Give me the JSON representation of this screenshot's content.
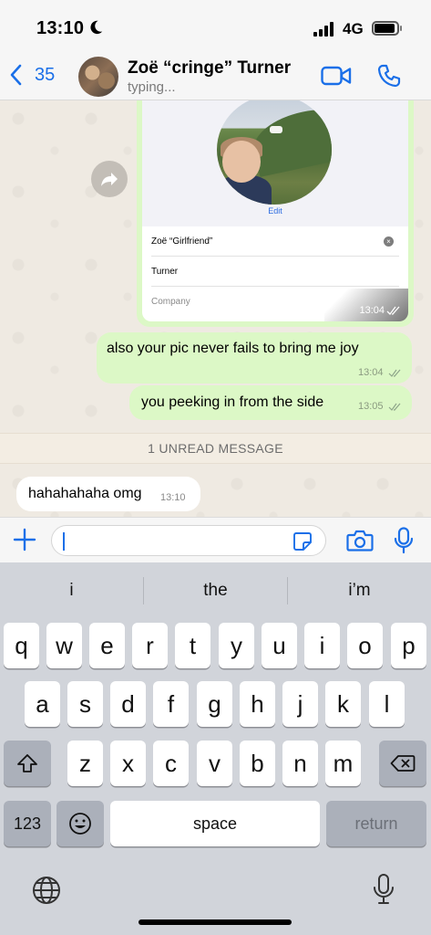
{
  "status_bar": {
    "time": "13:10",
    "network": "4G"
  },
  "header": {
    "back_count": "35",
    "contact_name": "Zoë “cringe” Turner",
    "contact_status": "typing..."
  },
  "contact_card": {
    "edit_label": "Edit",
    "first_name": "Zoë “Girlfriend”",
    "last_name": "Turner",
    "company_placeholder": "Company",
    "time": "13:04"
  },
  "messages": [
    {
      "direction": "outgoing",
      "text": "also your pic never fails to bring me joy",
      "time": "13:04"
    },
    {
      "direction": "outgoing",
      "text": "you peeking in from the side",
      "time": "13:05"
    },
    {
      "direction": "incoming",
      "text": "hahahahaha omg",
      "time": "13:10"
    }
  ],
  "unread_banner": "1 UNREAD MESSAGE",
  "compose": {
    "input_value": ""
  },
  "keyboard": {
    "suggestions": [
      "i",
      "the",
      "i’m"
    ],
    "row1": [
      "q",
      "w",
      "e",
      "r",
      "t",
      "y",
      "u",
      "i",
      "o",
      "p"
    ],
    "row2": [
      "a",
      "s",
      "d",
      "f",
      "g",
      "h",
      "j",
      "k",
      "l"
    ],
    "row3": [
      "z",
      "x",
      "c",
      "v",
      "b",
      "n",
      "m"
    ],
    "numbers_label": "123",
    "space_label": "space",
    "return_label": "return"
  },
  "colors": {
    "accent": "#1a6fe8",
    "outgoing_bubble": "#dcf8c6",
    "incoming_bubble": "#ffffff",
    "chat_bg": "#efeae2"
  }
}
